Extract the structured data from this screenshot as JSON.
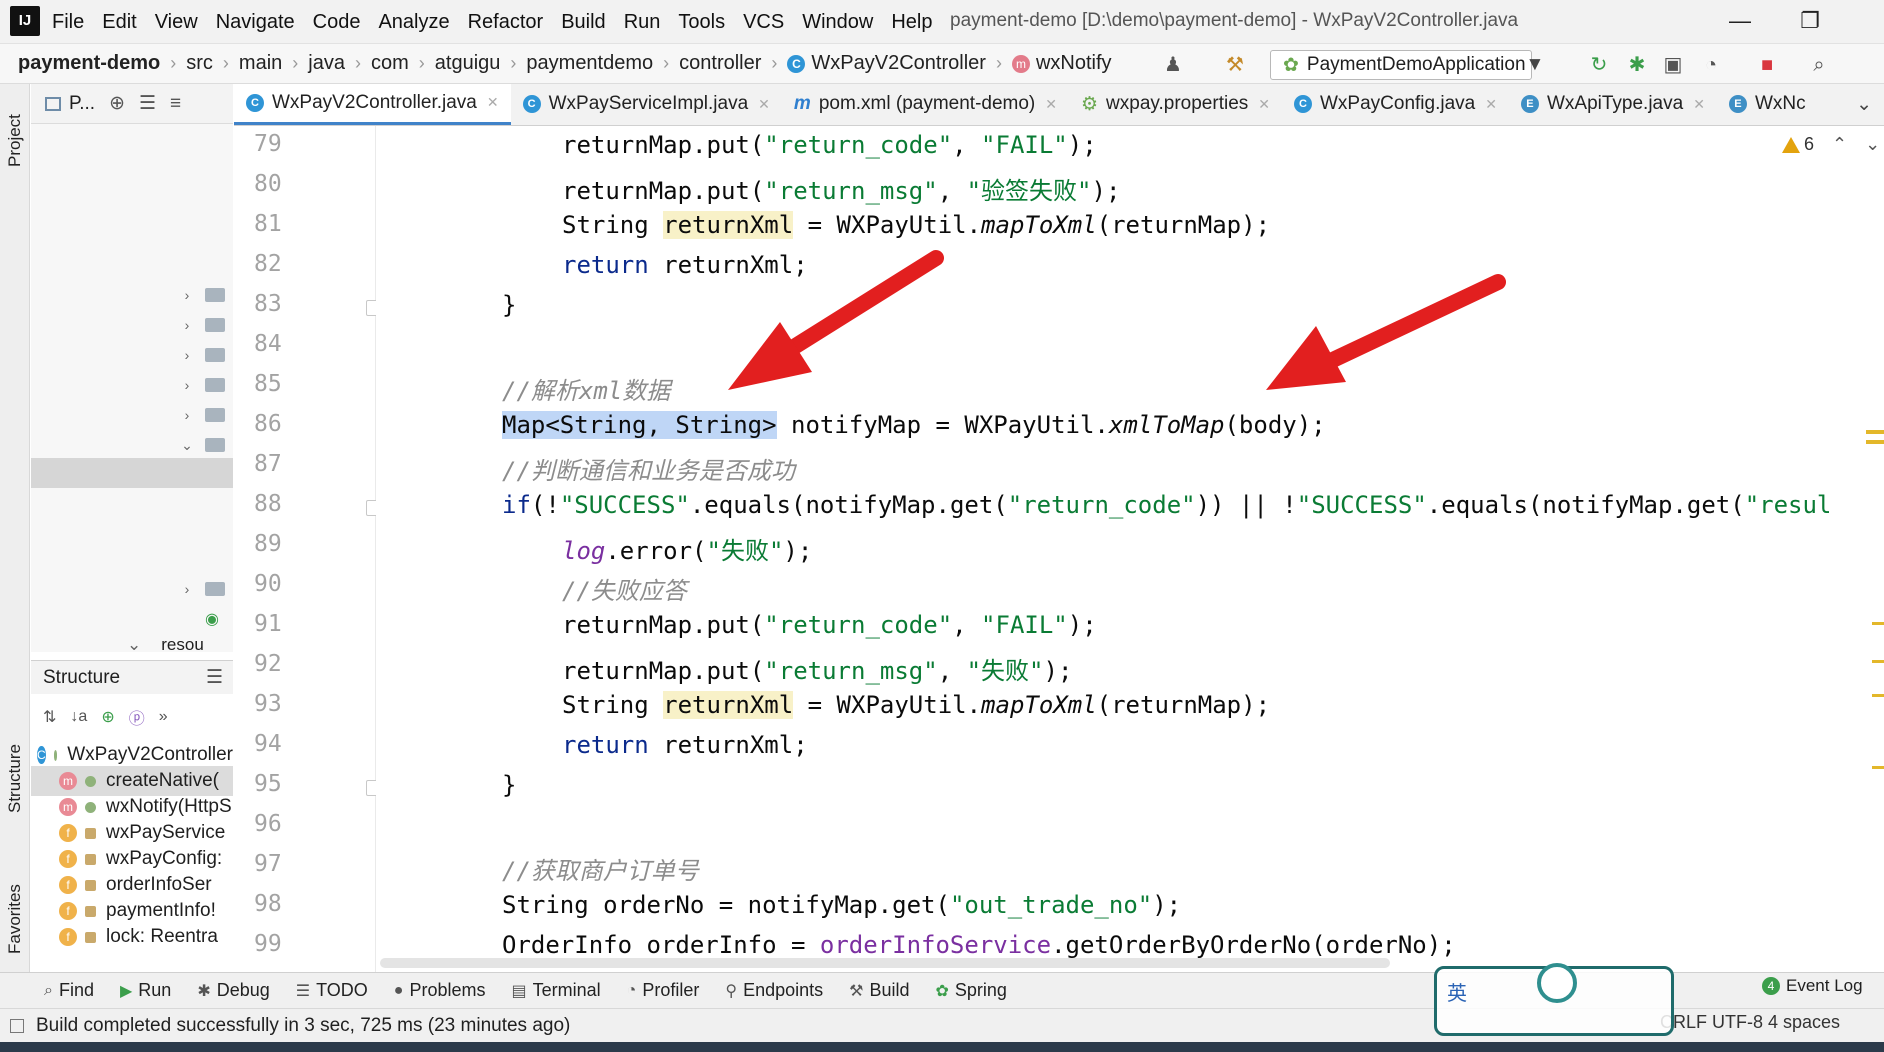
{
  "titlebar": {
    "logo": "IJ",
    "menu": [
      {
        "label": "File"
      },
      {
        "label": "Edit"
      },
      {
        "label": "View"
      },
      {
        "label": "Navigate"
      },
      {
        "label": "Code"
      },
      {
        "label": "Analyze"
      },
      {
        "label": "Refactor"
      },
      {
        "label": "Build"
      },
      {
        "label": "Run"
      },
      {
        "label": "Tools"
      },
      {
        "label": "VCS"
      },
      {
        "label": "Window"
      },
      {
        "label": "Help"
      }
    ],
    "window_title": "payment-demo [D:\\demo\\payment-demo] - WxPayV2Controller.java",
    "minimize": "—",
    "restore": "❐"
  },
  "navbar": {
    "crumbs": [
      "payment-demo",
      "src",
      "main",
      "java",
      "com",
      "atguigu",
      "paymentdemo",
      "controller",
      "WxPayV2Controller",
      "wxNotify"
    ],
    "run_config": "PaymentDemoApplication"
  },
  "project": {
    "header": "P..."
  },
  "structure": {
    "header": "Structure",
    "items": [
      {
        "label": "WxPayV2Controller",
        "badge": "c"
      },
      {
        "label": "createNative(",
        "badge": "m"
      },
      {
        "label": "wxNotify(HttpS",
        "badge": "m"
      },
      {
        "label": "wxPayService",
        "badge": "f"
      },
      {
        "label": "wxPayConfig:",
        "badge": "f"
      },
      {
        "label": "orderInfoSer",
        "badge": "f"
      },
      {
        "label": "paymentInfo!",
        "badge": "f"
      },
      {
        "label": "lock: Reentra",
        "badge": "f"
      }
    ],
    "partial_resource": "resou"
  },
  "tabs": [
    {
      "label": "WxPayV2Controller.java",
      "icon": "c",
      "active": true
    },
    {
      "label": "WxPayServiceImpl.java",
      "icon": "c",
      "active": false
    },
    {
      "label": "pom.xml (payment-demo)",
      "icon": "m",
      "active": false
    },
    {
      "label": "wxpay.properties",
      "icon": "p",
      "active": false
    },
    {
      "label": "WxPayConfig.java",
      "icon": "c",
      "active": false
    },
    {
      "label": "WxApiType.java",
      "icon": "e",
      "active": false
    },
    {
      "label": "WxNc",
      "icon": "e",
      "active": false
    }
  ],
  "editor": {
    "warnings": "6",
    "line_numbers": [
      "79",
      "80",
      "81",
      "82",
      "83",
      "84",
      "85",
      "86",
      "87",
      "88",
      "89",
      "90",
      "91",
      "92",
      "93",
      "94",
      "95",
      "96",
      "97",
      "98",
      "99"
    ]
  },
  "bottombar": {
    "tools": [
      "Find",
      "Run",
      "Debug",
      "TODO",
      "Problems",
      "Terminal",
      "Profiler",
      "Endpoints",
      "Build",
      "Spring"
    ],
    "event_log": "Event Log",
    "event_count": "4"
  },
  "status": {
    "message": "Build completed successfully in 3 sec, 725 ms (23 minutes ago)",
    "encoding": "CRLF  UTF-8  4 spaces"
  },
  "colors": {
    "keyword": "#0b2a8c",
    "string": "#0a7b34",
    "comment": "#8c8c8c",
    "arrow": "#e21f1f",
    "selection": "#bfd6f6"
  }
}
